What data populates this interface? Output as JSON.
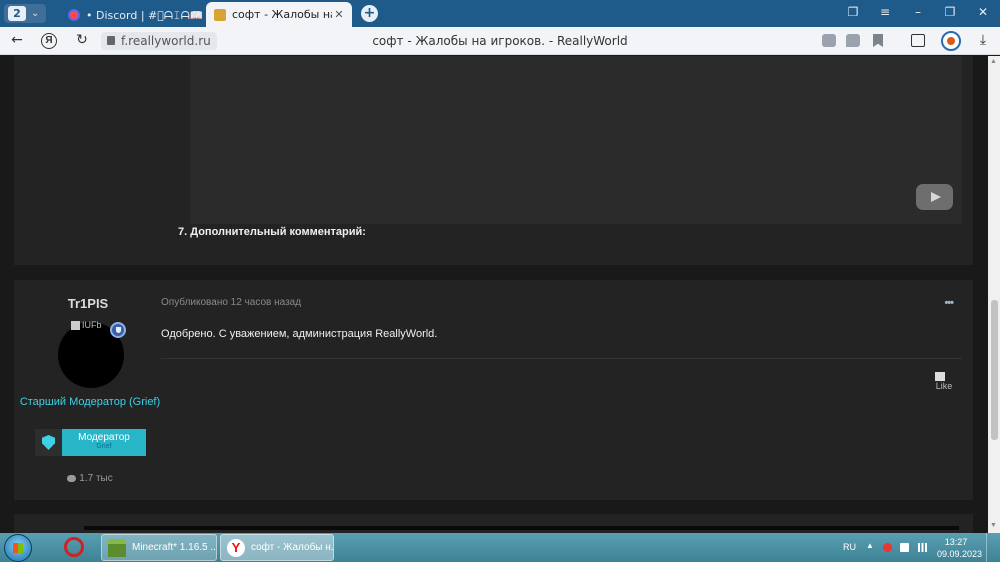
{
  "browser": {
    "tab_count": "2",
    "tabs": [
      {
        "title": "• Discord | #゙ᗩ𝙸ᗩ📖ͺノ|подде"
      },
      {
        "title": "софт - Жалобы на игрок"
      }
    ],
    "new_tab": "+",
    "address": {
      "url": "f.reallyworld.ru",
      "page_title": "софт - Жалобы на игроков. - ReallyWorld",
      "yandex_label": "Я"
    }
  },
  "page": {
    "post1": {
      "comment_heading": "7. Дополнительный комментарий:"
    },
    "post2": {
      "username": "Tr1PIS",
      "avatar_alt": "IUFb",
      "rank": "Старший Модератор (Grief)",
      "badge_title": "Модератор",
      "badge_sub": "Grief",
      "post_count": "1.7 тыс",
      "published": "Опубликовано 12 часов назад",
      "more": "•••",
      "body": "Одобрено. С уважением, администрация ReallyWorld.",
      "like_label": "Like"
    }
  },
  "taskbar": {
    "tasks": [
      {
        "title": "Minecraft* 1.16.5 ..."
      },
      {
        "title": "софт - Жалобы н..."
      }
    ],
    "lang": "RU",
    "time": "13:27",
    "date": "09.09.2023"
  },
  "colors": {
    "accent": "#3dd0e6",
    "badge": "#27b6c8",
    "chrome": "#1e5a8a",
    "page_bg": "#191919",
    "card_bg": "#232323"
  }
}
